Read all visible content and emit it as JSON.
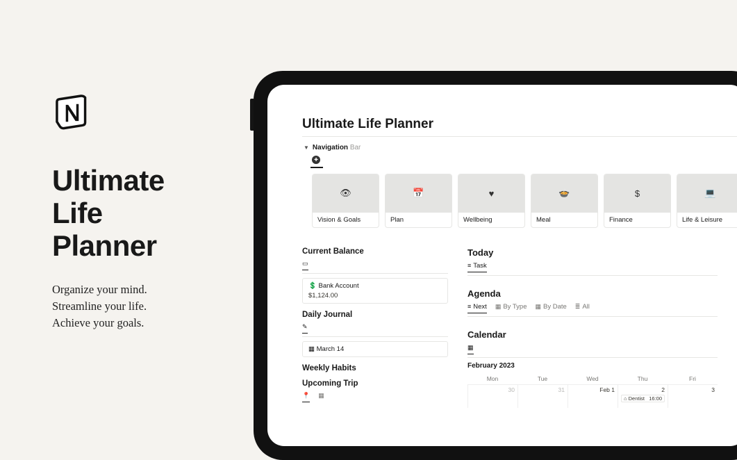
{
  "hero": {
    "title_l1": "Ultimate",
    "title_l2": "Life",
    "title_l3": "Planner",
    "tagline_l1": "Organize your mind.",
    "tagline_l2": "Streamline your life.",
    "tagline_l3": "Achieve your goals."
  },
  "page": {
    "title": "Ultimate Life Planner",
    "nav_toggle_label": "Navigation",
    "nav_toggle_suffix": " Bar"
  },
  "nav_cards": [
    {
      "label": "Vision & Goals",
      "icon": "👁"
    },
    {
      "label": "Plan",
      "icon": "📅"
    },
    {
      "label": "Wellbeing",
      "icon": "♥"
    },
    {
      "label": "Meal",
      "icon": "🍲"
    },
    {
      "label": "Finance",
      "icon": "$"
    },
    {
      "label": "Life & Leisure",
      "icon": "💻"
    }
  ],
  "left_col": {
    "balance_title": "Current Balance",
    "balance_card_title": "Bank Account",
    "balance_card_value": "$1,124.00",
    "journal_title": "Daily Journal",
    "journal_entry": "March 14",
    "habits_title": "Weekly Habits",
    "trip_title": "Upcoming Trip"
  },
  "right_col": {
    "today_title": "Today",
    "today_tab": "Task",
    "agenda_title": "Agenda",
    "agenda_tabs": [
      "Next",
      "By Type",
      "By Date",
      "All"
    ],
    "calendar_title": "Calendar",
    "cal_month": "February 2023",
    "cal_dow": [
      "Mon",
      "Tue",
      "Wed",
      "Thu",
      "Fri"
    ],
    "cal_days": [
      "30",
      "31",
      "Feb 1",
      "2",
      "3"
    ],
    "event_name": "Dentist",
    "event_time": "16:00"
  }
}
